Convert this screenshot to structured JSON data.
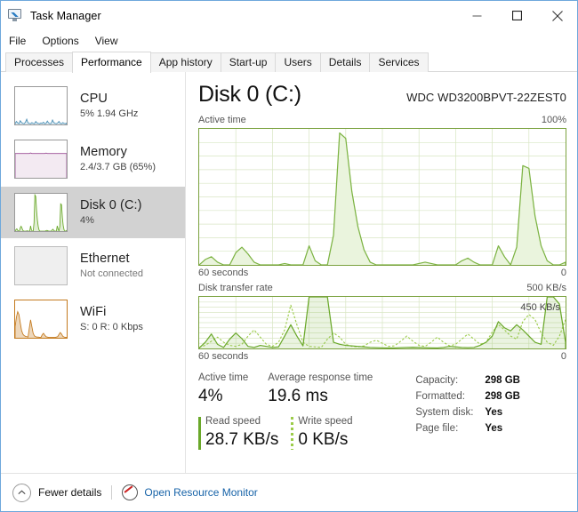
{
  "window": {
    "title": "Task Manager",
    "icon": "task-manager-icon",
    "controls": {
      "minimize": "minimize",
      "maximize": "maximize",
      "close": "close"
    }
  },
  "menu": {
    "items": [
      "File",
      "Options",
      "View"
    ]
  },
  "tabs": {
    "items": [
      "Processes",
      "Performance",
      "App history",
      "Start-up",
      "Users",
      "Details",
      "Services"
    ],
    "active": "Performance"
  },
  "sidebar": {
    "items": [
      {
        "name": "CPU",
        "title": "CPU",
        "sub": "5%  1.94 GHz",
        "color": "#4a8fb5",
        "muted": false
      },
      {
        "name": "Memory",
        "title": "Memory",
        "sub": "2.4/3.7 GB (65%)",
        "color": "#9b4f96",
        "muted": false
      },
      {
        "name": "Disk",
        "title": "Disk 0 (C:)",
        "sub": "4%",
        "color": "#6aa82a",
        "muted": false,
        "selected": true
      },
      {
        "name": "Ethernet",
        "title": "Ethernet",
        "sub": "Not connected",
        "color": "#c0c0c0",
        "muted": true
      },
      {
        "name": "WiFi",
        "title": "WiFi",
        "sub": "S: 0 R: 0 Kbps",
        "color": "#c47a1e",
        "muted": false
      }
    ]
  },
  "main": {
    "title": "Disk 0 (C:)",
    "model": "WDC WD3200BPVT-22ZEST0",
    "active_time_chart": {
      "label": "Active time",
      "max_label": "100%",
      "left_foot": "60 seconds",
      "right_foot": "0"
    },
    "transfer_chart": {
      "label": "Disk transfer rate",
      "max_label": "500 KB/s",
      "note": "450 KB/s",
      "left_foot": "60 seconds",
      "right_foot": "0"
    },
    "stats": {
      "active_time_label": "Active time",
      "active_time_value": "4%",
      "response_label": "Average response time",
      "response_value": "19.6 ms",
      "read_label": "Read speed",
      "read_value": "28.7 KB/s",
      "write_label": "Write speed",
      "write_value": "0 KB/s"
    },
    "info": [
      {
        "key": "Capacity:",
        "value": "298 GB"
      },
      {
        "key": "Formatted:",
        "value": "298 GB"
      },
      {
        "key": "System disk:",
        "value": "Yes"
      },
      {
        "key": "Page file:",
        "value": "Yes"
      }
    ]
  },
  "footer": {
    "fewer_details": "Fewer details",
    "fewer_icon": "chevron-up-circle-icon",
    "resource_monitor": "Open Resource Monitor",
    "resource_icon": "gauge-icon"
  },
  "colors": {
    "disk_green": "#6aa82a",
    "disk_green_light": "#9ccc4a",
    "disk_fill": "#eaf4dd",
    "grid": "#d8e6c4",
    "link": "#1763a8",
    "selected_bg": "#d2d2d2"
  },
  "chart_data": [
    {
      "type": "area",
      "name": "active-time",
      "title": "Active time",
      "xlabel": "60 seconds",
      "ylabel": "%",
      "ylim": [
        0,
        100
      ],
      "xlim": [
        60,
        0
      ],
      "grid": true,
      "grid_cols": 10,
      "grid_rows": 10,
      "x": [
        0,
        1,
        2,
        3,
        4,
        5,
        6,
        7,
        8,
        9,
        10,
        11,
        12,
        13,
        14,
        15,
        16,
        17,
        18,
        19,
        20,
        21,
        22,
        23,
        24,
        25,
        26,
        27,
        28,
        29,
        30,
        31,
        32,
        33,
        34,
        35,
        36,
        37,
        38,
        39,
        40,
        41,
        42,
        43,
        44,
        45,
        46,
        47,
        48,
        49,
        50,
        51,
        52,
        53,
        54,
        55,
        56,
        57,
        58,
        59,
        60
      ],
      "values": [
        0,
        4,
        6,
        2,
        0,
        0,
        9,
        13,
        8,
        2,
        0,
        0,
        0,
        0,
        1,
        0,
        0,
        0,
        14,
        3,
        0,
        0,
        22,
        97,
        93,
        54,
        28,
        11,
        2,
        0,
        0,
        0,
        0,
        0,
        0,
        0,
        1,
        2,
        1,
        0,
        0,
        0,
        0,
        3,
        5,
        2,
        0,
        0,
        0,
        14,
        6,
        0,
        13,
        73,
        71,
        36,
        14,
        3,
        0,
        0,
        2
      ]
    },
    {
      "type": "line",
      "name": "disk-transfer-rate",
      "title": "Disk transfer rate",
      "xlabel": "60 seconds",
      "ylabel": "KB/s",
      "ylim": [
        0,
        500
      ],
      "xlim": [
        60,
        0
      ],
      "grid": true,
      "grid_cols": 10,
      "grid_rows": 10,
      "annotation": "450 KB/s",
      "annotation_value": 450,
      "x": [
        0,
        1,
        2,
        3,
        4,
        5,
        6,
        7,
        8,
        9,
        10,
        11,
        12,
        13,
        14,
        15,
        16,
        17,
        18,
        19,
        20,
        21,
        22,
        23,
        24,
        25,
        26,
        27,
        28,
        29,
        30,
        31,
        32,
        33,
        34,
        35,
        36,
        37,
        38,
        39,
        40,
        41,
        42,
        43,
        44,
        45,
        46,
        47,
        48,
        49,
        50,
        51,
        52,
        53,
        54,
        55,
        56,
        57,
        58,
        59,
        60
      ],
      "series": [
        {
          "name": "Read speed",
          "style": "solid",
          "color": "#6aa82a",
          "values": [
            5,
            60,
            140,
            40,
            10,
            90,
            150,
            95,
            20,
            10,
            30,
            20,
            10,
            15,
            120,
            230,
            120,
            25,
            500,
            500,
            500,
            500,
            60,
            40,
            30,
            25,
            20,
            15,
            10,
            8,
            6,
            5,
            5,
            8,
            10,
            12,
            10,
            8,
            6,
            5,
            10,
            20,
            15,
            10,
            8,
            10,
            30,
            60,
            120,
            260,
            200,
            170,
            230,
            180,
            120,
            60,
            40,
            500,
            500,
            430,
            60
          ]
        },
        {
          "name": "Write speed",
          "style": "dotted",
          "color": "#9ccc4a",
          "values": [
            10,
            30,
            70,
            110,
            60,
            30,
            20,
            40,
            120,
            180,
            110,
            40,
            20,
            60,
            180,
            420,
            230,
            60,
            20,
            15,
            10,
            90,
            150,
            110,
            40,
            20,
            15,
            25,
            60,
            80,
            50,
            20,
            25,
            70,
            120,
            70,
            30,
            20,
            60,
            110,
            60,
            25,
            40,
            90,
            140,
            90,
            40,
            60,
            160,
            230,
            180,
            120,
            90,
            260,
            330,
            280,
            150,
            60,
            30,
            120,
            280
          ]
        }
      ]
    }
  ]
}
